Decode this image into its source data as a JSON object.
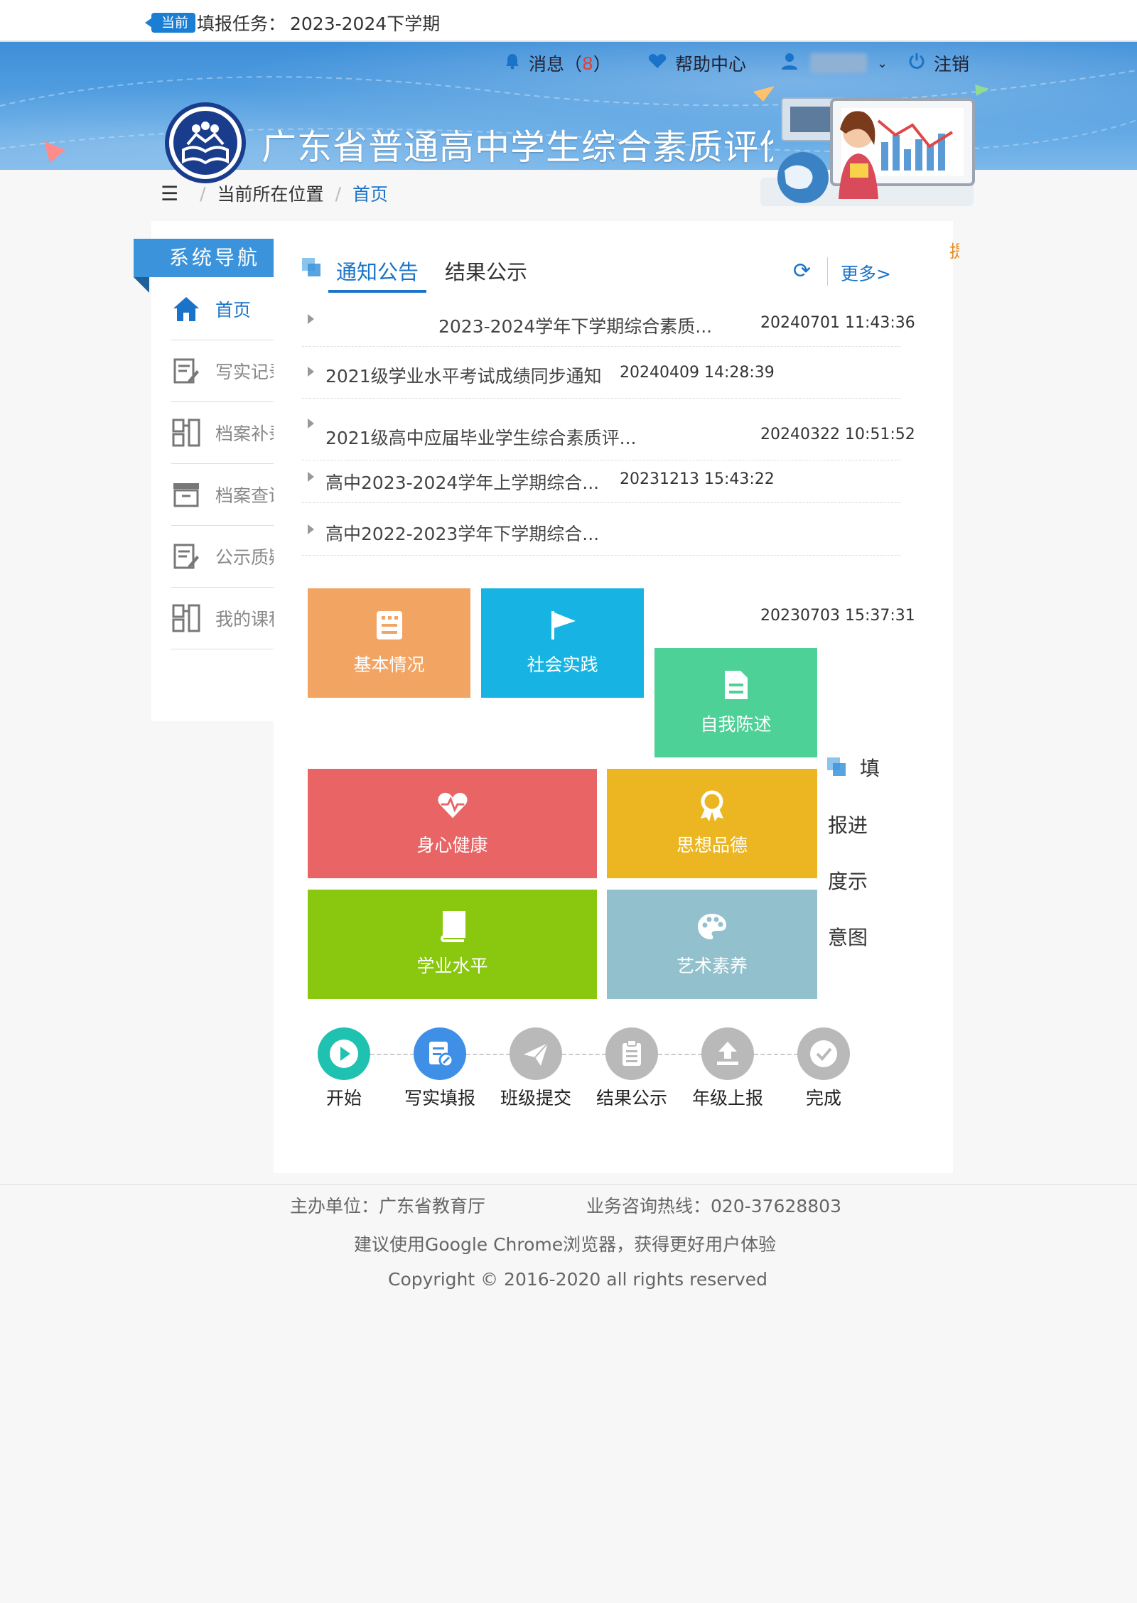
{
  "task": {
    "badge": "当前",
    "label": "填报任务：",
    "value": "2023-2024下学期"
  },
  "header": {
    "site_title": "广东省普通高中学生综合素质评价信息管理系统",
    "nav": {
      "messages_label": "消息（",
      "messages_count": "8",
      "messages_close": "）",
      "help": "帮助中心",
      "logout": "注销"
    }
  },
  "breadcrumb": {
    "prefix": "当前所在位置",
    "current": "首页"
  },
  "sidebar": {
    "title": "系统导航",
    "items": [
      {
        "label": "首页",
        "icon": "home-icon"
      },
      {
        "label": "写实记录",
        "icon": "edit-icon"
      },
      {
        "label": "档案补录",
        "icon": "swap-icon"
      },
      {
        "label": "档案查询",
        "icon": "archive-icon"
      },
      {
        "label": "公示质疑",
        "icon": "edit-icon"
      },
      {
        "label": "我的课程",
        "icon": "swap-icon"
      }
    ]
  },
  "tabs": {
    "notice": "通知公告",
    "result": "结果公示",
    "more": "更多>"
  },
  "edge_text": "提示",
  "notices": [
    {
      "title": "2023-2024学年下学期综合素质...",
      "time": "20240701 11:43:36"
    },
    {
      "title": "2021级学业水平考试成绩同步通知",
      "time": "20240409 14:28:39"
    },
    {
      "title": "2021级高中应届毕业学生综合素质评...",
      "time": "20240322 10:51:52"
    },
    {
      "title": "高中2023-2024学年上学期综合...",
      "time": "20231213 15:43:22"
    },
    {
      "title": "高中2022-2023学年下学期综合...",
      "time": "20230703 15:37:31"
    }
  ],
  "tiles": {
    "basic": "基本情况",
    "social": "社会实践",
    "self": "自我陈述",
    "health": "身心健康",
    "moral": "思想品德",
    "academic": "学业水平",
    "art": "艺术素养"
  },
  "side_caption": [
    "填",
    "报进",
    "度示",
    "意图"
  ],
  "steps": [
    {
      "label": "开始",
      "color": "#1fc1b0"
    },
    {
      "label": "写实填报",
      "color": "#3f8fe6"
    },
    {
      "label": "班级提交",
      "color": "#b9b9b9"
    },
    {
      "label": "结果公示",
      "color": "#b9b9b9"
    },
    {
      "label": "年级上报",
      "color": "#b9b9b9"
    },
    {
      "label": "完成",
      "color": "#b9b9b9"
    }
  ],
  "footer": {
    "sponsor": "主办单位：广东省教育厅",
    "hotline": "业务咨询热线：020-37628803",
    "browser": "建议使用Google Chrome浏览器，获得更好用户体验",
    "copyright": "Copyright © 2016-2020 all rights reserved"
  }
}
